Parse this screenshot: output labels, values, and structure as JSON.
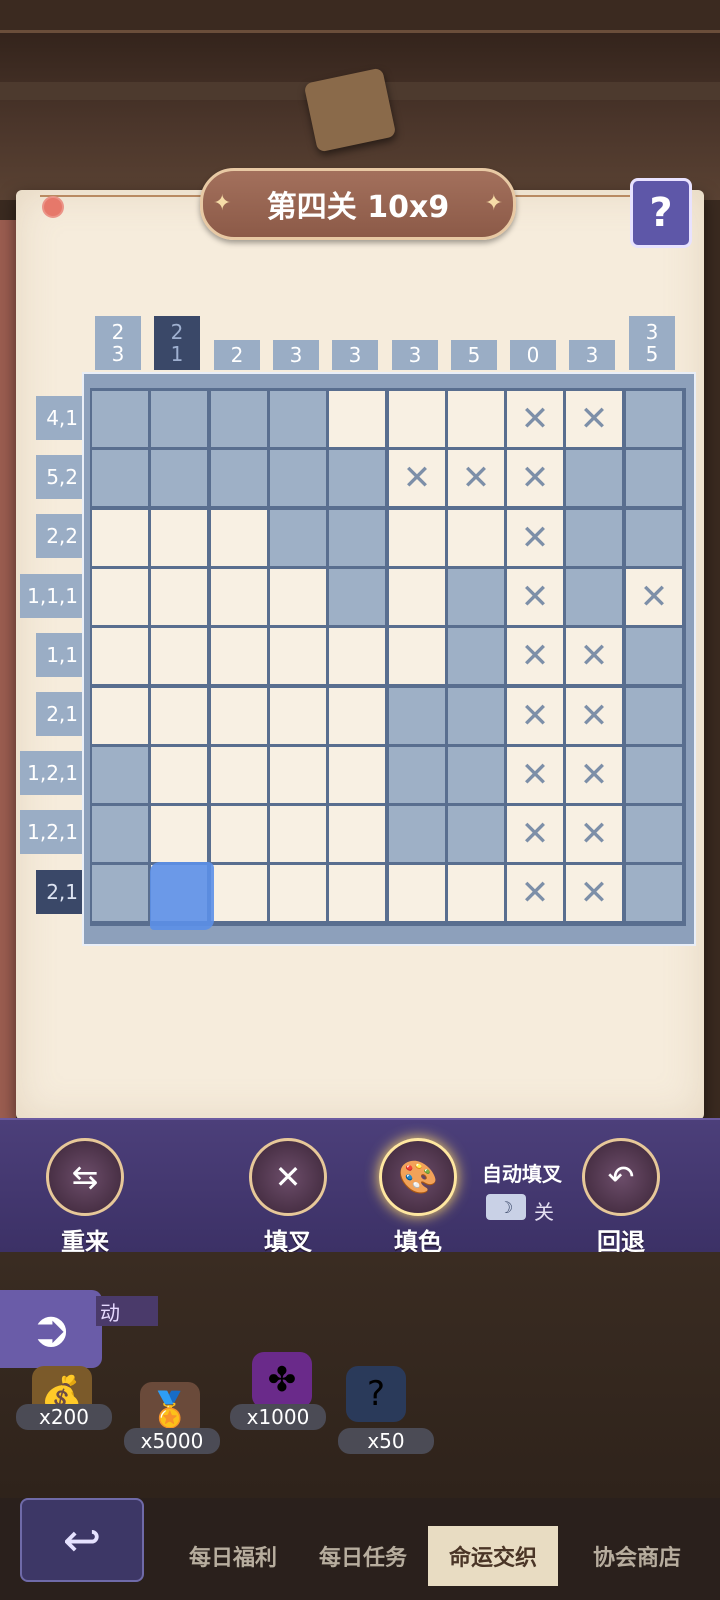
{
  "level": {
    "title": "第四关 10x9",
    "help": "?"
  },
  "column_clues": [
    [
      "2",
      "3"
    ],
    [
      "2",
      "1"
    ],
    [
      "2"
    ],
    [
      "3"
    ],
    [
      "3"
    ],
    [
      "3"
    ],
    [
      "5"
    ],
    [
      "0"
    ],
    [
      "3"
    ],
    [
      "3",
      "5"
    ]
  ],
  "active_column": 1,
  "row_clues": [
    "4,1",
    "5,2",
    "2,2",
    "1,1,1",
    "1,1",
    "2,1",
    "1,2,1",
    "1,2,1",
    "2,1"
  ],
  "active_row": 8,
  "grid": [
    "FFFF...XXF",
    "FFFFFXXXFF",
    "...FF..XFF",
    "....F.FXFX",
    "......FXXF",
    ".....FFXXF",
    "F....FFXXF",
    "F....FFXXF",
    "F......XXF"
  ],
  "toolbar": {
    "restart": "重来",
    "cross": "填叉",
    "fill": "填色",
    "auto_cross_label": "自动填叉",
    "auto_cross_state": "关",
    "undo": "回退"
  },
  "side_tag": "动",
  "rewards": [
    {
      "count": "x200",
      "icon": "money-bag-icon"
    },
    {
      "count": "x5000",
      "icon": "wing-badge-icon"
    },
    {
      "count": "x1000",
      "icon": "puzzle-piece-icon"
    },
    {
      "count": "x50",
      "icon": "mystery-card-icon"
    }
  ],
  "nav": [
    {
      "label": "每日福利",
      "active": false
    },
    {
      "label": "每日任务",
      "active": false
    },
    {
      "label": "命运交织",
      "active": true
    },
    {
      "label": "协会商店",
      "active": false
    }
  ],
  "colors": {
    "filled": "#9eb0c6",
    "empty": "#f8f0e3",
    "active_clue": "#3a4868",
    "clue": "#9aadc5"
  }
}
